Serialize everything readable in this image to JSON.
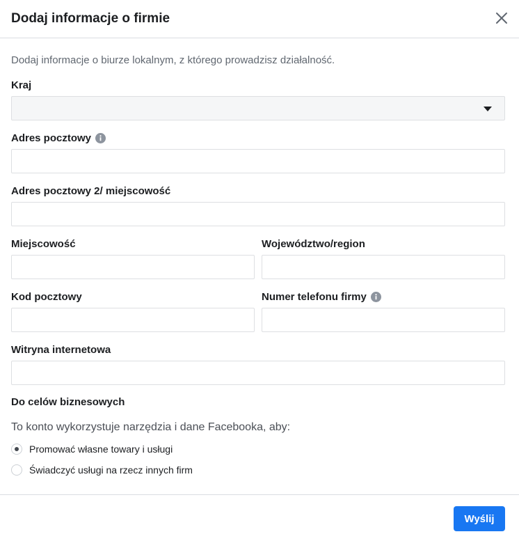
{
  "dialog": {
    "title": "Dodaj informacje o firmie",
    "intro": "Dodaj informacje o biurze lokalnym, z którego prowadzisz działalność."
  },
  "form": {
    "country_label": "Kraj",
    "country_value": "",
    "address1_label": "Adres pocztowy",
    "address2_label": "Adres pocztowy 2/ miejscowość",
    "city_label": "Miejscowość",
    "region_label": "Województwo/region",
    "postal_label": "Kod pocztowy",
    "phone_label": "Numer telefonu firmy",
    "website_label": "Witryna internetowa"
  },
  "business": {
    "title": "Do celów biznesowych",
    "description": "To konto wykorzystuje narzędzia i dane Facebooka, aby:",
    "options": [
      {
        "label": "Promować własne towary i usługi",
        "selected": true
      },
      {
        "label": "Świadczyć usługi na rzecz innych firm",
        "selected": false
      }
    ]
  },
  "footer": {
    "submit_label": "Wyślij"
  },
  "colors": {
    "accent": "#1877f2",
    "border": "#dddfe2",
    "select_bg": "#f5f6f7"
  },
  "icons": [
    "close-icon",
    "info-icon",
    "caret-down-icon"
  ]
}
